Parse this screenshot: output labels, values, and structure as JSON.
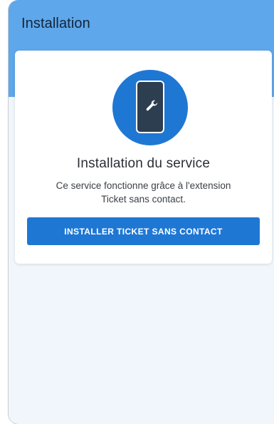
{
  "appbar": {
    "title": "Installation"
  },
  "card": {
    "icon": "phone-wrench-icon",
    "title": "Installation du service",
    "description_line1": "Ce service fonctionne grâce à l'extension",
    "description_line2": "Ticket sans contact.",
    "button_label": "INSTALLER TICKET SANS CONTACT"
  },
  "colors": {
    "appbar": "#5ea7ea",
    "primary": "#1f77d4",
    "background": "#f1f6fd",
    "phone_screen": "#2d3e50"
  }
}
